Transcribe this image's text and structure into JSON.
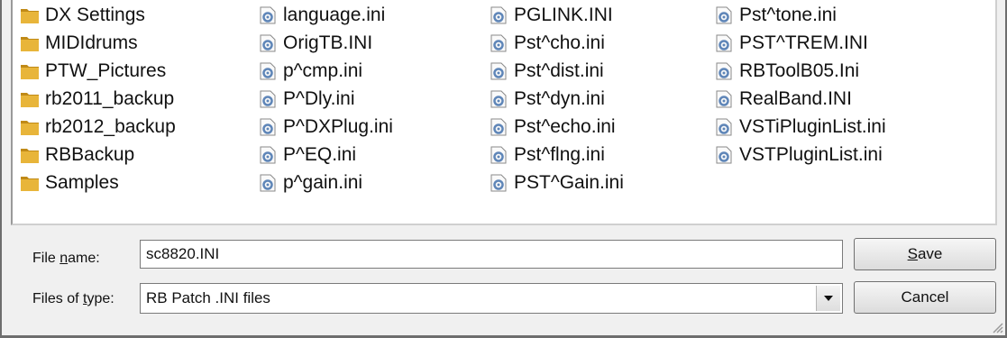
{
  "files": {
    "columns": [
      [
        {
          "name": "DX Settings",
          "type": "folder"
        },
        {
          "name": "MIDIdrums",
          "type": "folder"
        },
        {
          "name": "PTW_Pictures",
          "type": "folder"
        },
        {
          "name": "rb2011_backup",
          "type": "folder"
        },
        {
          "name": "rb2012_backup",
          "type": "folder"
        },
        {
          "name": "RBBackup",
          "type": "folder"
        },
        {
          "name": "Samples",
          "type": "folder"
        }
      ],
      [
        {
          "name": "language.ini",
          "type": "ini"
        },
        {
          "name": "OrigTB.INI",
          "type": "ini"
        },
        {
          "name": "p^cmp.ini",
          "type": "ini"
        },
        {
          "name": "P^Dly.ini",
          "type": "ini"
        },
        {
          "name": "P^DXPlug.ini",
          "type": "ini"
        },
        {
          "name": "P^EQ.ini",
          "type": "ini"
        },
        {
          "name": "p^gain.ini",
          "type": "ini"
        }
      ],
      [
        {
          "name": "PGLINK.INI",
          "type": "ini"
        },
        {
          "name": "Pst^cho.ini",
          "type": "ini"
        },
        {
          "name": "Pst^dist.ini",
          "type": "ini"
        },
        {
          "name": "Pst^dyn.ini",
          "type": "ini"
        },
        {
          "name": "Pst^echo.ini",
          "type": "ini"
        },
        {
          "name": "Pst^flng.ini",
          "type": "ini"
        },
        {
          "name": "PST^Gain.ini",
          "type": "ini"
        }
      ],
      [
        {
          "name": "Pst^tone.ini",
          "type": "ini"
        },
        {
          "name": "PST^TREM.INI",
          "type": "ini"
        },
        {
          "name": "RBToolB05.Ini",
          "type": "ini"
        },
        {
          "name": "RealBand.INI",
          "type": "ini"
        },
        {
          "name": "VSTiPluginList.ini",
          "type": "ini"
        },
        {
          "name": "VSTPluginList.ini",
          "type": "ini"
        }
      ]
    ]
  },
  "form": {
    "file_name_label_pre": "File ",
    "file_name_label_key": "n",
    "file_name_label_post": "ame:",
    "file_name_value": "sc8820.INI",
    "files_of_type_label_pre": "Files of ",
    "files_of_type_label_key": "t",
    "files_of_type_label_post": "ype:",
    "files_of_type_value": "RB Patch .INI files"
  },
  "buttons": {
    "save_key": "S",
    "save_rest": "ave",
    "cancel_label": "Cancel"
  },
  "colors": {
    "folder": "#e8b53a",
    "folder_dark": "#c08a17",
    "ini_gear": "#5f86b8"
  },
  "icons": {
    "folder": "folder-icon",
    "ini": "ini-file-icon",
    "dropdown": "chevron-down-icon",
    "grip": "resize-grip-icon"
  }
}
